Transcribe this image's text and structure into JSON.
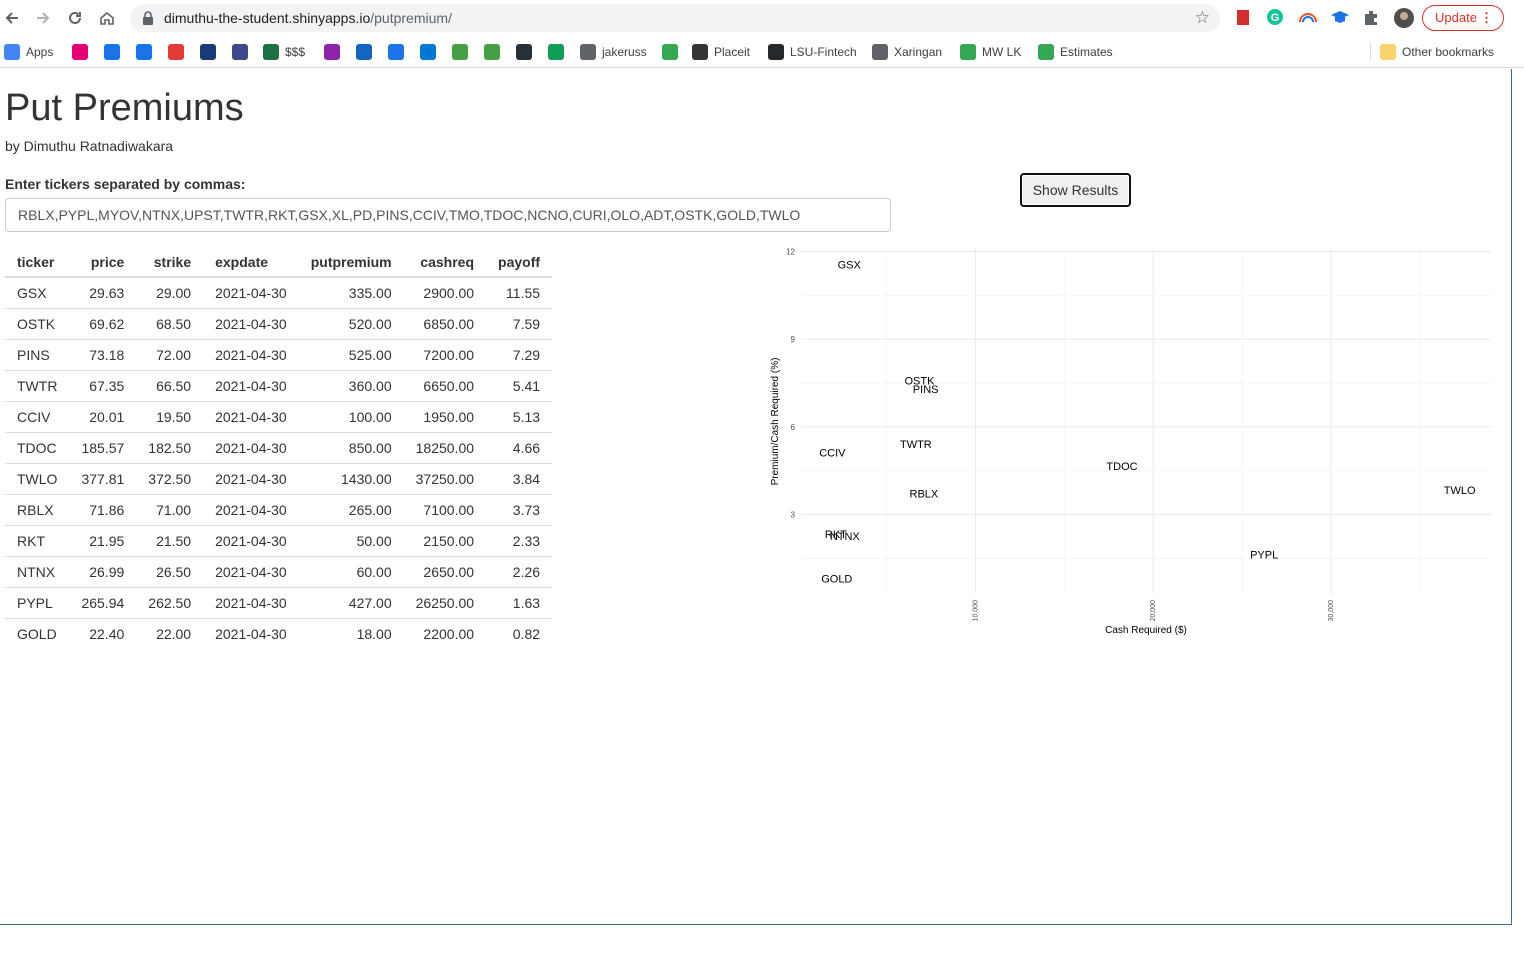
{
  "browser": {
    "url_host": "dimuthu-the-student.shinyapps.io",
    "url_path": "/putpremium/",
    "update_label": "Update",
    "bookmarks": [
      {
        "label": "Apps",
        "icon": "apps-grid-icon",
        "color": "#4285f4"
      },
      {
        "label": "",
        "icon": "t-mobile-icon",
        "color": "#e20074"
      },
      {
        "label": "",
        "icon": "code-bracket-icon",
        "color": "#1a73e8"
      },
      {
        "label": "",
        "icon": "code-bracket-icon",
        "color": "#1a73e8"
      },
      {
        "label": "",
        "icon": "bookmark-app-icon",
        "color": "#e53935"
      },
      {
        "label": "",
        "icon": "wikipedia-icon",
        "color": "#1a3b7a"
      },
      {
        "label": "",
        "icon": "ssrn-icon",
        "color": "#3a4a8a"
      },
      {
        "label": "$$$",
        "icon": "excel-icon",
        "color": "#1e7145"
      },
      {
        "label": "",
        "icon": "slack-icon",
        "color": "#8e24aa"
      },
      {
        "label": "",
        "icon": "atom-icon",
        "color": "#1565c0"
      },
      {
        "label": "",
        "icon": "chat-icon",
        "color": "#1a73e8"
      },
      {
        "label": "",
        "icon": "outlook-icon",
        "color": "#0078d4"
      },
      {
        "label": "",
        "icon": "chart-icon",
        "color": "#43a047"
      },
      {
        "label": "",
        "icon": "leaf-icon",
        "color": "#43a047"
      },
      {
        "label": "",
        "icon": "news-icon",
        "color": "#263238"
      },
      {
        "label": "",
        "icon": "sheets-icon",
        "color": "#0f9d58"
      },
      {
        "label": "jakeruss",
        "icon": "globe-icon",
        "color": "#5f6368"
      },
      {
        "label": "",
        "icon": "w-icon",
        "color": "#34a853"
      },
      {
        "label": "Placeit",
        "icon": "placeit-icon",
        "color": "#333333"
      },
      {
        "label": "LSU-Fintech",
        "icon": "github-icon",
        "color": "#24292e"
      },
      {
        "label": "Xaringan",
        "icon": "globe-icon",
        "color": "#5f6368"
      },
      {
        "label": "MW LK",
        "icon": "w-icon",
        "color": "#34a853"
      },
      {
        "label": "Estimates",
        "icon": "w-icon",
        "color": "#34a853"
      }
    ],
    "other_bookmarks": "Other bookmarks"
  },
  "app": {
    "title": "Put Premiums",
    "byline": "by Dimuthu Ratnadiwakara",
    "input_label": "Enter tickers separated by commas:",
    "input_value": "RBLX,PYPL,MYOV,NTNX,UPST,TWTR,RKT,GSX,XL,PD,PINS,CCIV,TMO,TDOC,NCNO,CURI,OLO,ADT,OSTK,GOLD,TWLO",
    "button_label": "Show Results"
  },
  "table": {
    "columns": [
      "ticker",
      "price",
      "strike",
      "expdate",
      "putpremium",
      "cashreq",
      "payoff"
    ],
    "rows": [
      [
        "GSX",
        "29.63",
        "29.00",
        "2021-04-30",
        "335.00",
        "2900.00",
        "11.55"
      ],
      [
        "OSTK",
        "69.62",
        "68.50",
        "2021-04-30",
        "520.00",
        "6850.00",
        "7.59"
      ],
      [
        "PINS",
        "73.18",
        "72.00",
        "2021-04-30",
        "525.00",
        "7200.00",
        "7.29"
      ],
      [
        "TWTR",
        "67.35",
        "66.50",
        "2021-04-30",
        "360.00",
        "6650.00",
        "5.41"
      ],
      [
        "CCIV",
        "20.01",
        "19.50",
        "2021-04-30",
        "100.00",
        "1950.00",
        "5.13"
      ],
      [
        "TDOC",
        "185.57",
        "182.50",
        "2021-04-30",
        "850.00",
        "18250.00",
        "4.66"
      ],
      [
        "TWLO",
        "377.81",
        "372.50",
        "2021-04-30",
        "1430.00",
        "37250.00",
        "3.84"
      ],
      [
        "RBLX",
        "71.86",
        "71.00",
        "2021-04-30",
        "265.00",
        "7100.00",
        "3.73"
      ],
      [
        "RKT",
        "21.95",
        "21.50",
        "2021-04-30",
        "50.00",
        "2150.00",
        "2.33"
      ],
      [
        "NTNX",
        "26.99",
        "26.50",
        "2021-04-30",
        "60.00",
        "2650.00",
        "2.26"
      ],
      [
        "PYPL",
        "265.94",
        "262.50",
        "2021-04-30",
        "427.00",
        "26250.00",
        "1.63"
      ],
      [
        "GOLD",
        "22.40",
        "22.00",
        "2021-04-30",
        "18.00",
        "2200.00",
        "0.82"
      ]
    ]
  },
  "chart_data": {
    "type": "scatter",
    "xlabel": "Cash Required ($)",
    "ylabel": "Premium/Cash Required (%)",
    "xlim": [
      1950,
      37250
    ],
    "ylim": [
      0.82,
      11.55
    ],
    "x_ticks": [
      10000,
      20000,
      30000
    ],
    "x_tick_labels": [
      "10,000",
      "20,000",
      "30,000"
    ],
    "y_ticks": [
      3,
      6,
      9,
      12
    ],
    "y_tick_labels": [
      "3",
      "6",
      "9",
      "12"
    ],
    "grid": true,
    "points": [
      {
        "label": "GSX",
        "x": 2900,
        "y": 11.55
      },
      {
        "label": "OSTK",
        "x": 6850,
        "y": 7.59
      },
      {
        "label": "PINS",
        "x": 7200,
        "y": 7.29
      },
      {
        "label": "TWTR",
        "x": 6650,
        "y": 5.41
      },
      {
        "label": "CCIV",
        "x": 1950,
        "y": 5.13
      },
      {
        "label": "TDOC",
        "x": 18250,
        "y": 4.66
      },
      {
        "label": "TWLO",
        "x": 37250,
        "y": 3.84
      },
      {
        "label": "RBLX",
        "x": 7100,
        "y": 3.73
      },
      {
        "label": "RKT",
        "x": 2150,
        "y": 2.33
      },
      {
        "label": "NTNX",
        "x": 2650,
        "y": 2.26
      },
      {
        "label": "PYPL",
        "x": 26250,
        "y": 1.63
      },
      {
        "label": "GOLD",
        "x": 2200,
        "y": 0.82
      }
    ]
  }
}
